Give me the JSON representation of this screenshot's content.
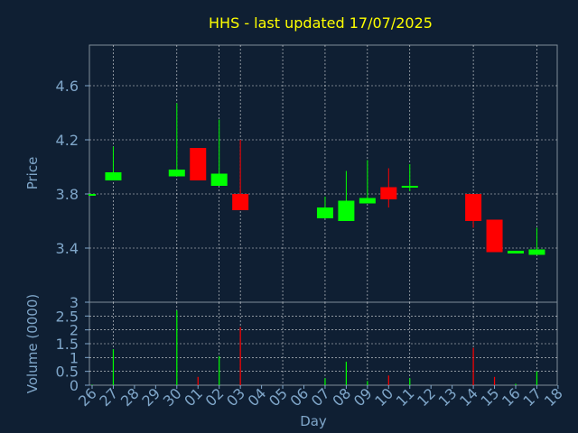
{
  "chart_data": [
    {
      "type": "candlestick",
      "title": "HHS - last updated 17/07/2025",
      "ylabel": "Price",
      "xlabel": "",
      "ylim": [
        3.0,
        4.9
      ],
      "yticks": [
        "3",
        "3.4",
        "3.8",
        "4.2",
        "4.6"
      ],
      "ytick_values": [
        3.0,
        3.4,
        3.8,
        4.2,
        4.6
      ],
      "grid": true,
      "up_color": "#00ff00",
      "down_color": "#ff0000",
      "candles": [
        {
          "day": "26",
          "open": 3.8,
          "close": 3.8,
          "high": 3.8,
          "low": 3.8
        },
        {
          "day": "27",
          "open": 3.9,
          "close": 3.96,
          "high": 4.15,
          "low": 3.9
        },
        {
          "day": "30",
          "open": 3.93,
          "close": 3.98,
          "high": 4.47,
          "low": 3.93
        },
        {
          "day": "01",
          "open": 4.14,
          "close": 3.9,
          "high": 4.14,
          "low": 3.9
        },
        {
          "day": "02",
          "open": 3.86,
          "close": 3.95,
          "high": 4.35,
          "low": 3.86
        },
        {
          "day": "03",
          "open": 3.8,
          "close": 3.68,
          "high": 4.2,
          "low": 3.68
        },
        {
          "day": "07",
          "open": 3.62,
          "close": 3.7,
          "high": 3.78,
          "low": 3.62
        },
        {
          "day": "08",
          "open": 3.6,
          "close": 3.75,
          "high": 3.97,
          "low": 3.6
        },
        {
          "day": "09",
          "open": 3.73,
          "close": 3.77,
          "high": 4.05,
          "low": 3.73
        },
        {
          "day": "10",
          "open": 3.85,
          "close": 3.76,
          "high": 3.99,
          "low": 3.7
        },
        {
          "day": "11",
          "open": 3.86,
          "close": 3.86,
          "high": 4.02,
          "low": 3.82
        },
        {
          "day": "14",
          "open": 3.8,
          "close": 3.6,
          "high": 3.8,
          "low": 3.55
        },
        {
          "day": "15",
          "open": 3.61,
          "close": 3.37,
          "high": 3.61,
          "low": 3.37
        },
        {
          "day": "16",
          "open": 3.36,
          "close": 3.38,
          "high": 3.38,
          "low": 3.36
        },
        {
          "day": "17",
          "open": 3.35,
          "close": 3.39,
          "high": 3.55,
          "low": 3.35
        }
      ]
    },
    {
      "type": "bar",
      "ylabel": "Volume (0000)",
      "xlabel": "Day",
      "ylim": [
        0,
        3
      ],
      "yticks": [
        "0",
        "0.5",
        "1",
        "1.5",
        "2",
        "2.5",
        "3"
      ],
      "ytick_values": [
        0,
        0.5,
        1,
        1.5,
        2,
        2.5,
        3
      ],
      "categories": [
        "26",
        "27",
        "28",
        "29",
        "30",
        "01",
        "02",
        "03",
        "04",
        "05",
        "06",
        "07",
        "08",
        "09",
        "10",
        "11",
        "12",
        "13",
        "14",
        "15",
        "16",
        "17",
        "18"
      ],
      "grid": true,
      "bars": [
        {
          "day": "26",
          "value": 0.02,
          "color": "#00ff00"
        },
        {
          "day": "27",
          "value": 1.3,
          "color": "#00ff00"
        },
        {
          "day": "30",
          "value": 2.7,
          "color": "#00ff00"
        },
        {
          "day": "01",
          "value": 0.3,
          "color": "#ff0000"
        },
        {
          "day": "02",
          "value": 1.05,
          "color": "#00ff00"
        },
        {
          "day": "03",
          "value": 2.1,
          "color": "#ff0000"
        },
        {
          "day": "07",
          "value": 0.25,
          "color": "#00ff00"
        },
        {
          "day": "08",
          "value": 0.85,
          "color": "#00ff00"
        },
        {
          "day": "09",
          "value": 0.15,
          "color": "#00ff00"
        },
        {
          "day": "10",
          "value": 0.35,
          "color": "#ff0000"
        },
        {
          "day": "11",
          "value": 0.25,
          "color": "#00ff00"
        },
        {
          "day": "14",
          "value": 1.35,
          "color": "#ff0000"
        },
        {
          "day": "15",
          "value": 0.3,
          "color": "#ff0000"
        },
        {
          "day": "16",
          "value": 0.05,
          "color": "#00ff00"
        },
        {
          "day": "17",
          "value": 0.5,
          "color": "#00ff00"
        }
      ]
    }
  ]
}
